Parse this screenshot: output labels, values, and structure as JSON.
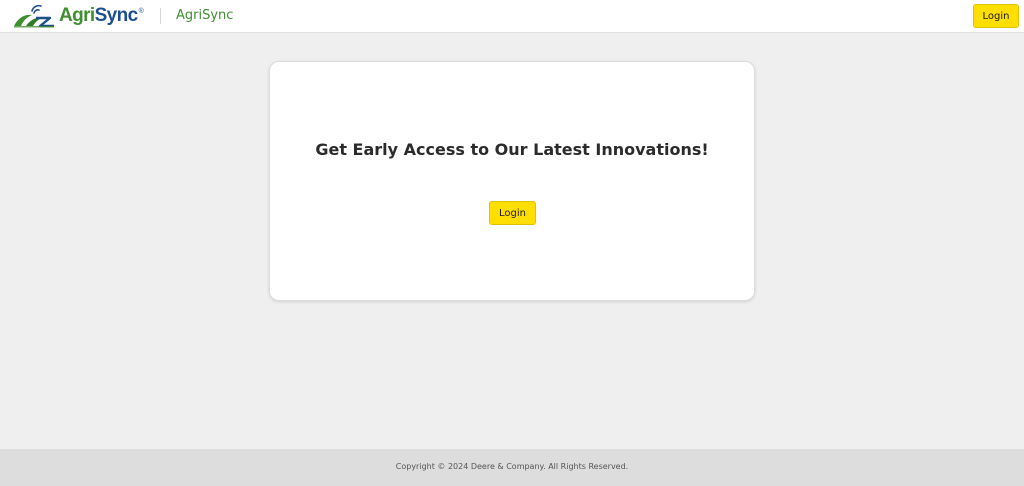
{
  "header": {
    "logo": {
      "text_agri": "Agri",
      "text_sync": "Sync",
      "registered_mark": "®",
      "icon": "agrisync-leaf-signal-icon"
    },
    "app_name": "AgriSync",
    "login_label": "Login"
  },
  "main": {
    "card": {
      "title": "Get Early Access to Our Latest Innovations!",
      "login_label": "Login"
    }
  },
  "footer": {
    "copyright": "Copyright © 2024 Deere & Company. All Rights Reserved."
  },
  "colors": {
    "page_background": "#efefef",
    "header_background": "#ffffff",
    "footer_background": "#dddddd",
    "button_yellow": "#ffde00",
    "brand_green": "#3f8e2f",
    "brand_blue": "#1d4f8b"
  }
}
